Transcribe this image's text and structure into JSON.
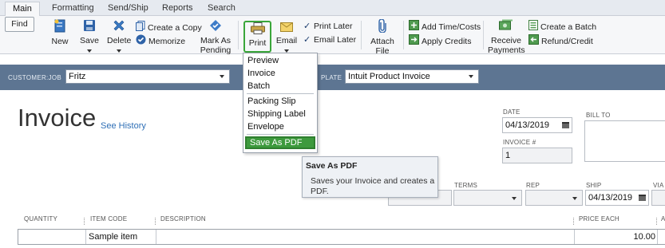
{
  "tabs": [
    "Main",
    "Formatting",
    "Send/Ship",
    "Reports",
    "Search"
  ],
  "ribbon": {
    "find": "Find",
    "new": "New",
    "save": "Save",
    "delete": "Delete",
    "create_copy": "Create a Copy",
    "memorize": "Memorize",
    "mark_as_pending_1": "Mark As",
    "mark_as_pending_2": "Pending",
    "print": "Print",
    "email": "Email",
    "print_later": "Print Later",
    "email_later": "Email Later",
    "attach_file_1": "Attach",
    "attach_file_2": "File",
    "add_time_costs": "Add Time/Costs",
    "apply_credits": "Apply Credits",
    "receive_payments_1": "Receive",
    "receive_payments_2": "Payments",
    "create_batch": "Create a Batch",
    "refund_credit": "Refund/Credit"
  },
  "customer_bar": {
    "customer_job_label": "CUSTOMER:JOB",
    "customer_job_value": "Fritz",
    "template_label": "PLATE",
    "template_value": "Intuit Product Invoice"
  },
  "form": {
    "title": "Invoice",
    "see_history": "See History",
    "date_label": "DATE",
    "date_value": "04/13/2019",
    "invoice_no_label": "INVOICE #",
    "invoice_no_value": "1",
    "bill_to_label": "BILL TO",
    "terms_label": "TERMS",
    "rep_label": "REP",
    "ship_label": "SHIP",
    "ship_value": "04/13/2019",
    "via_label": "VIA"
  },
  "table": {
    "headers": [
      "QUANTITY",
      "ITEM CODE",
      "DESCRIPTION",
      "PRICE EACH",
      "A"
    ],
    "rows": [
      {
        "quantity": "",
        "item_code": "Sample item",
        "description": "",
        "price_each": "10.00"
      }
    ]
  },
  "print_menu": {
    "items": [
      "Preview",
      "Invoice",
      "Batch",
      "Packing Slip",
      "Shipping Label",
      "Envelope",
      "Save As PDF"
    ]
  },
  "tooltip": {
    "title": "Save As PDF",
    "body": "Saves your Invoice and creates a PDF."
  },
  "colors": {
    "customer_bar": "#5d7592",
    "highlight_green": "#3d9a3d",
    "link_blue": "#2f6fb6"
  }
}
